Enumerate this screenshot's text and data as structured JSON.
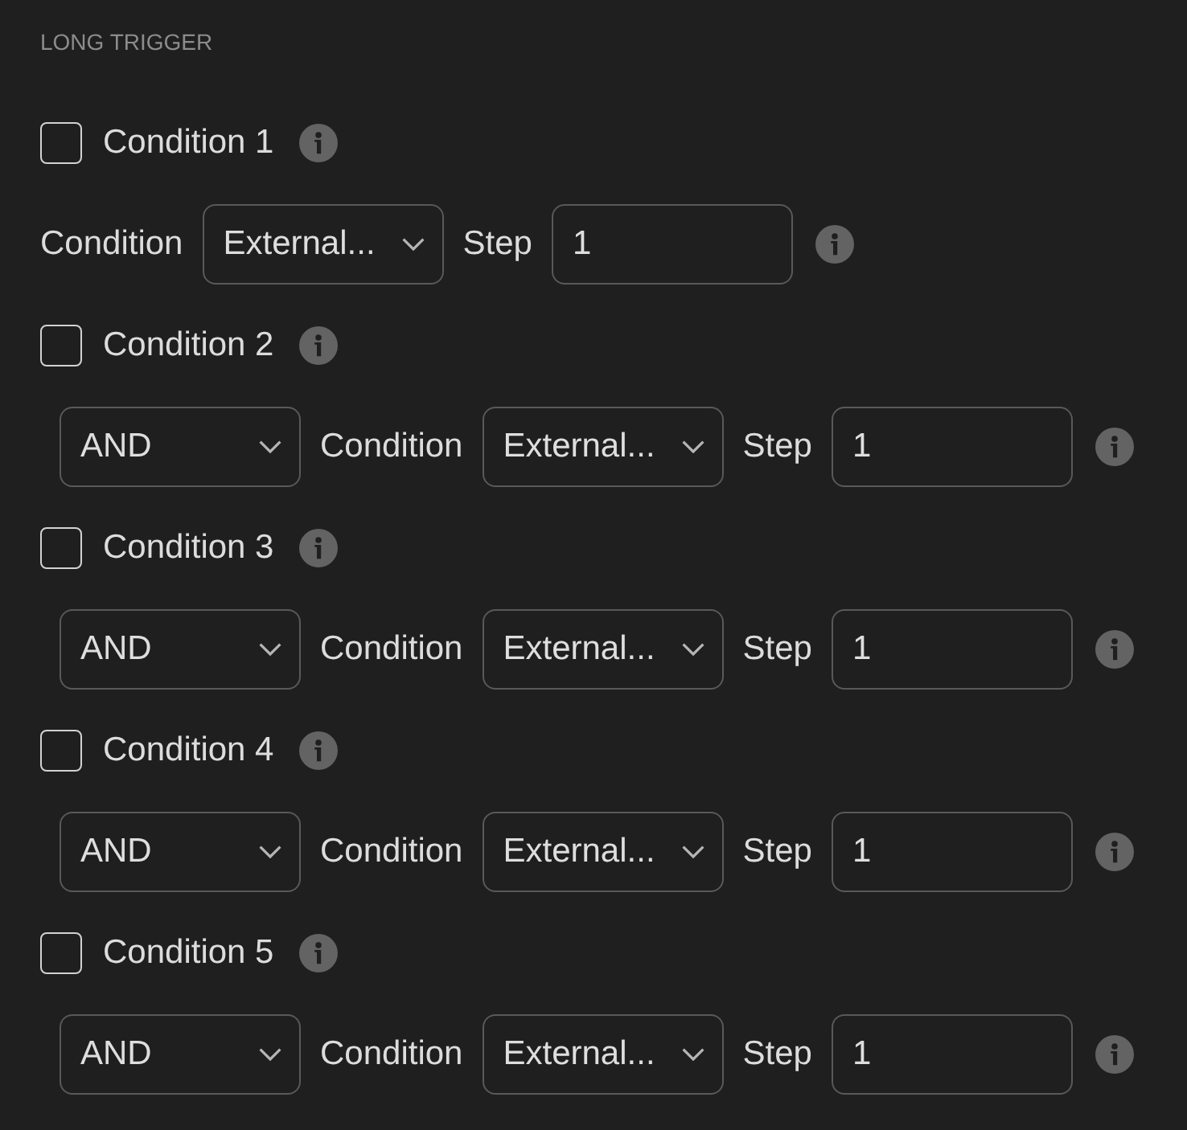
{
  "section": {
    "title": "LONG TRIGGER"
  },
  "conditions": [
    {
      "label": "Condition 1",
      "checked": false,
      "row": {
        "kind": "first",
        "condition_label": "Condition",
        "condition_value": "External...",
        "step_label": "Step",
        "step_value": "1"
      }
    },
    {
      "label": "Condition 2",
      "checked": false,
      "row": {
        "kind": "joined",
        "operator": "AND",
        "condition_label": "Condition",
        "condition_value": "External...",
        "step_label": "Step",
        "step_value": "1"
      }
    },
    {
      "label": "Condition 3",
      "checked": false,
      "row": {
        "kind": "joined",
        "operator": "AND",
        "condition_label": "Condition",
        "condition_value": "External...",
        "step_label": "Step",
        "step_value": "1"
      }
    },
    {
      "label": "Condition 4",
      "checked": false,
      "row": {
        "kind": "joined",
        "operator": "AND",
        "condition_label": "Condition",
        "condition_value": "External...",
        "step_label": "Step",
        "step_value": "1"
      }
    },
    {
      "label": "Condition 5",
      "checked": false,
      "row": {
        "kind": "joined",
        "operator": "AND",
        "condition_label": "Condition",
        "condition_value": "External...",
        "step_label": "Step",
        "step_value": "1"
      }
    }
  ]
}
